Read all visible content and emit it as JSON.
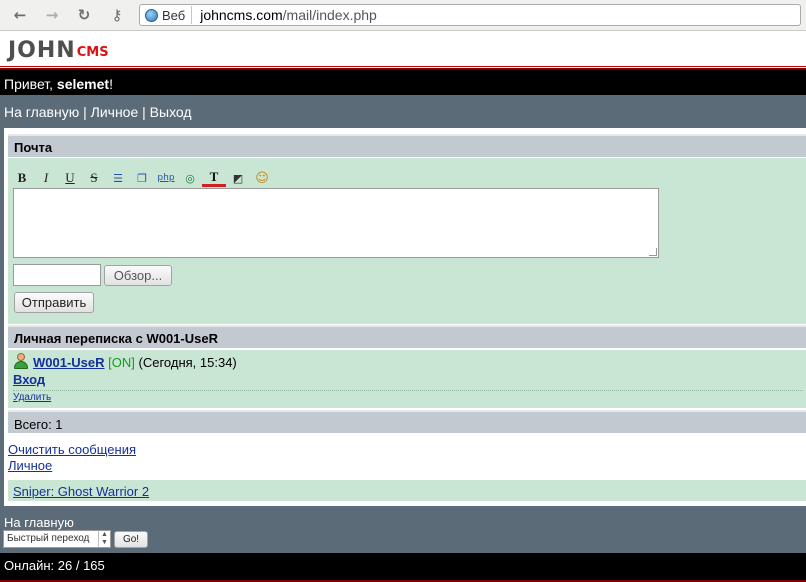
{
  "browser": {
    "search_chip_label": "Веб",
    "url_host": "johncms.com",
    "url_path": "/mail/index.php"
  },
  "logo": {
    "john": "JOHN",
    "cms": "CMS"
  },
  "greeting": {
    "prefix": "Привет, ",
    "username": "selemet",
    "suffix": "!"
  },
  "topnav": {
    "home": "На главную",
    "personal": "Личное",
    "logout": "Выход",
    "separator": " | "
  },
  "mail": {
    "header": "Почта",
    "toolbar_icons": [
      "bold-icon",
      "italic-icon",
      "underline-icon",
      "strikethrough-icon",
      "list-icon",
      "copy-icon",
      "php-icon",
      "link-icon",
      "text-color-icon",
      "background-color-icon",
      "smiley-icon"
    ],
    "toolbar_glyphs": [
      "B",
      "I",
      "U",
      "S",
      "☰",
      "❐",
      "php",
      "◎",
      "T",
      "◩",
      "☺"
    ],
    "browse_label": "Обзор...",
    "send_label": "Отправить"
  },
  "conversation": {
    "header": "Личная переписка с W001-UseR",
    "messages": [
      {
        "user": "W001-UseR",
        "status": "[ON]",
        "time": "(Сегодня, 15:34)",
        "text": "Вход",
        "delete": "Удалить"
      }
    ],
    "total": "Всего: 1"
  },
  "links": {
    "clear_messages": "Очистить сообщения",
    "personal": "Личное",
    "ad": "Sniper: Ghost Warrior 2"
  },
  "footer": {
    "home": "На главную",
    "quick_jump": "Быстрый переход",
    "go": "Go!",
    "online": "Онлайн: 26 / 165"
  }
}
